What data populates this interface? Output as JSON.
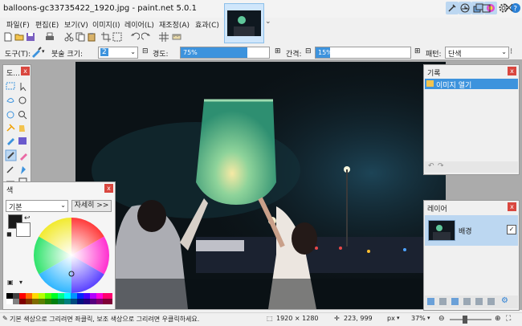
{
  "window": {
    "title": "balloons-gc33735422_1920.jpg - paint.net 5.0.1",
    "tab_chevron": "⌄"
  },
  "menu": {
    "items": [
      "파일(F)",
      "편집(E)",
      "보기(V)",
      "이미지(I)",
      "레이어(L)",
      "재조정(A)",
      "효과(C)"
    ]
  },
  "tool_options": {
    "tool_label": "도구(T):",
    "brush_width_label": "붓술 크기:",
    "brush_width_value": "2",
    "hardness_label": "경도:",
    "hardness_value": "75%",
    "hardness_fraction": 0.75,
    "spacing_label": "간격:",
    "spacing_value": "15%",
    "spacing_fraction": 0.15,
    "pattern_label": "패턴:",
    "pattern_value": "단색"
  },
  "tools_panel": {
    "title": "도..."
  },
  "colors_panel": {
    "title": "색",
    "mode_value": "기본",
    "more_button": "자세히 >>"
  },
  "history_panel": {
    "title": "기록",
    "items": [
      "이미지 열기"
    ]
  },
  "layers_panel": {
    "title": "레이어",
    "layers": [
      {
        "name": "배경",
        "visible": true
      }
    ]
  },
  "status": {
    "hint": "기본 색상으로 그리려면 좌클릭, 보조 색상으로 그리려면 우클릭하세요.",
    "image_size": "1920 × 1280",
    "cursor_pos": "223, 999",
    "unit": "px",
    "zoom": "37%"
  },
  "colors": {
    "accent": "#3d93dd",
    "close": "#d9473f",
    "primary_color": "#1a1a1a",
    "secondary_color": "#ffffff"
  }
}
